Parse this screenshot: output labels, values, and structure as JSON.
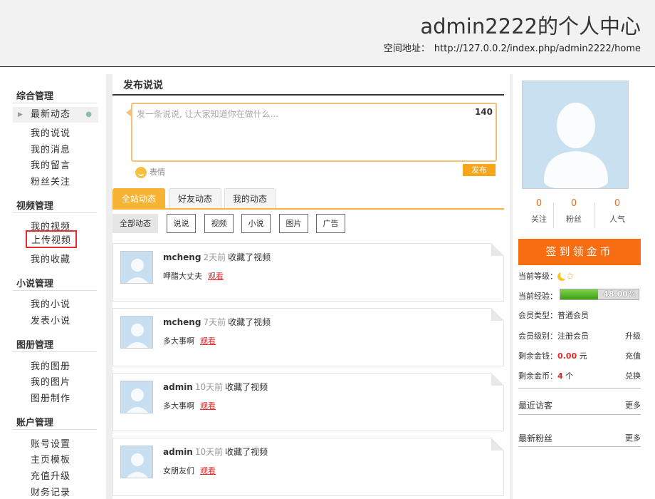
{
  "header": {
    "title": "admin2222的个人中心",
    "address_label": "空间地址：",
    "address_url": "http://127.0.0.2/index.php/admin2222/home"
  },
  "sidebar": {
    "groups": [
      {
        "title": "综合管理",
        "items": [
          "最新动态",
          "我的说说",
          "我的消息",
          "我的留言",
          "粉丝关注"
        ]
      },
      {
        "title": "视频管理",
        "items": [
          "我的视频",
          "上传视频",
          "我的收藏"
        ]
      },
      {
        "title": "小说管理",
        "items": [
          "我的小说",
          "发表小说"
        ]
      },
      {
        "title": "图册管理",
        "items": [
          "我的图册",
          "我的图片",
          "图册制作"
        ]
      },
      {
        "title": "账户管理",
        "items": [
          "账号设置",
          "主页模板",
          "充值升级",
          "财务记录"
        ]
      }
    ]
  },
  "publish": {
    "title": "发布说说",
    "placeholder": "发一条说说, 让大家知道你在做什么...",
    "char_count": "140",
    "emoji_label": "表情",
    "submit_label": "发布"
  },
  "tabs": [
    "全站动态",
    "好友动态",
    "我的动态"
  ],
  "filters": [
    "全部动态",
    "说说",
    "视频",
    "小说",
    "图片",
    "广告"
  ],
  "feed": [
    {
      "user": "mcheng",
      "time": "2天前",
      "action": "收藏了视频",
      "text": "呷醋大丈夫",
      "link": "观看"
    },
    {
      "user": "mcheng",
      "time": "7天前",
      "action": "收藏了视频",
      "text": "多大事啊",
      "link": "观看"
    },
    {
      "user": "admin",
      "time": "10天前",
      "action": "收藏了视频",
      "text": "多大事啊",
      "link": "观看"
    },
    {
      "user": "admin",
      "time": "10天前",
      "action": "收藏了视频",
      "text": "女朋友们",
      "link": "观看"
    }
  ],
  "profile": {
    "stats": [
      {
        "value": "0",
        "label": "关注"
      },
      {
        "value": "0",
        "label": "粉丝"
      },
      {
        "value": "0",
        "label": "人气"
      }
    ],
    "signin_label": "签到领金币",
    "level_label": "当前等级：",
    "exp_label": "当前经验：",
    "exp_percent_text": "48.00%",
    "exp_percent": 48,
    "member_type_label": "会员类型：普通会员",
    "member_level_label": "会员级别：注册会员",
    "upgrade_label": "升级",
    "money_label": "剩余金钱：",
    "money_value": "0.00",
    "money_unit": "元",
    "recharge_label": "充值",
    "coins_label": "剩余金币：",
    "coins_value": "4",
    "coins_unit": "个",
    "exchange_label": "兑换",
    "visitors_title": "最近访客",
    "fans_title": "最新粉丝",
    "more_label": "更多"
  },
  "colors": {
    "accent_orange": "#f86c12",
    "tab_yellow": "#f7b434",
    "link_red": "#e52b2b",
    "stat_orange": "#f36b1c",
    "exp_green": "#3e9e15"
  }
}
